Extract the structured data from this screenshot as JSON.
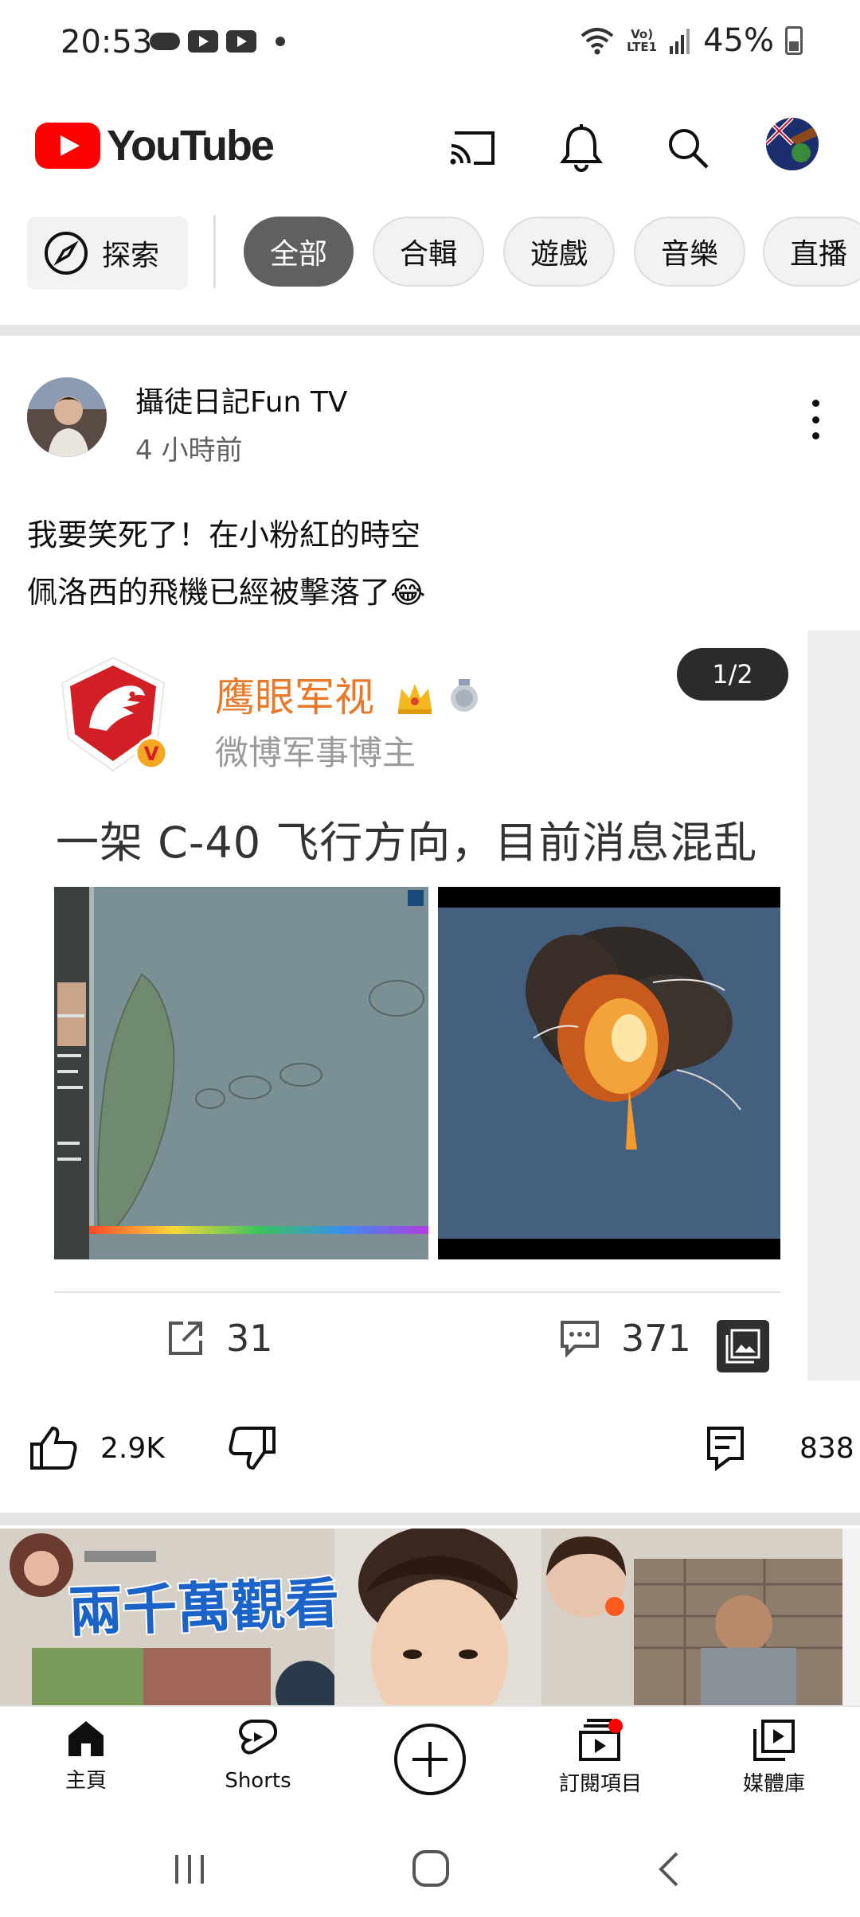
{
  "status_bar": {
    "time": "20:53",
    "battery": "45%",
    "network": "LTE1",
    "icons": [
      "cloud-icon",
      "youtube-notification-icon",
      "youtube-notification-icon",
      "dot-icon",
      "wifi-icon",
      "volte-icon",
      "signal-icon",
      "battery-icon"
    ]
  },
  "header": {
    "app_name": "YouTube",
    "icons": [
      "cast-icon",
      "bell-icon",
      "search-icon",
      "account-avatar"
    ],
    "brand_color": "#ff0000"
  },
  "chips": {
    "explore_label": "探索",
    "items": [
      "全部",
      "合輯",
      "遊戲",
      "音樂",
      "直播"
    ],
    "active": "全部"
  },
  "post": {
    "channel_name": "攝徒日記Fun TV",
    "time_ago": "4 小時前",
    "text_line1": "我要笑死了！在小粉紅的時空",
    "text_line2": "佩洛西的飛機已經被擊落了😂",
    "card": {
      "page_indicator": "1/2",
      "weibo_name": "鹰眼军视",
      "weibo_desc": "微博军事博主",
      "headline": "一架 C-40 飞行方向，目前消息混乱",
      "share_count": "31",
      "comment_count": "371"
    },
    "likes": "2.9K",
    "comments": "838"
  },
  "thumbnail": {
    "overlay_text": "兩千萬觀看"
  },
  "bottom_nav": {
    "items": [
      {
        "label": "主頁",
        "icon": "home-icon"
      },
      {
        "label": "Shorts",
        "icon": "shorts-icon"
      },
      {
        "label": "",
        "icon": "create-icon"
      },
      {
        "label": "訂閱項目",
        "icon": "subscriptions-icon"
      },
      {
        "label": "媒體庫",
        "icon": "library-icon"
      }
    ]
  }
}
